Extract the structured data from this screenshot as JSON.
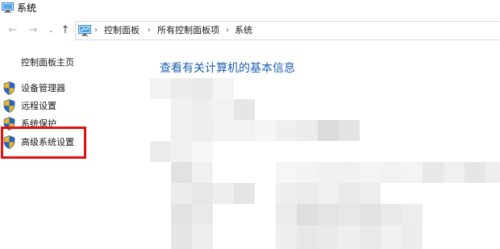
{
  "window": {
    "title": "系统",
    "icon": "computer-icon"
  },
  "nav": {
    "back_icon": "arrow-left-icon",
    "forward_icon": "arrow-right-icon",
    "up_icon": "arrow-up-icon"
  },
  "address_bar": {
    "icon": "control-panel-icon",
    "breadcrumbs": [
      "控制面板",
      "所有控制面板项",
      "系统"
    ],
    "separator": "›"
  },
  "sidebar": {
    "home": "控制面板主页",
    "items": [
      {
        "label": "设备管理器",
        "icon": "shield-icon"
      },
      {
        "label": "远程设置",
        "icon": "shield-icon"
      },
      {
        "label": "系统保护",
        "icon": "shield-icon"
      },
      {
        "label": "高级系统设置",
        "icon": "shield-icon"
      }
    ]
  },
  "main": {
    "heading": "查看有关计算机的基本信息"
  },
  "colors": {
    "link": "#1e5fb4",
    "highlight": "#e01212",
    "shield_blue": "#2a63c6",
    "shield_gold": "#e8b81e"
  }
}
